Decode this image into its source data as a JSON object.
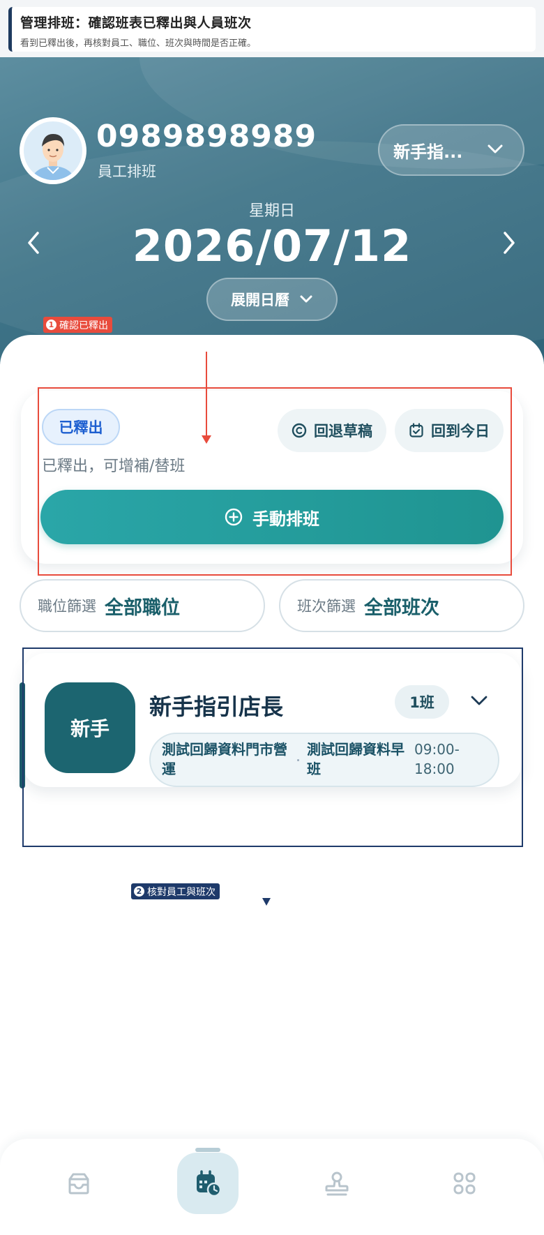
{
  "banner": {
    "title": "管理排班：確認班表已釋出與人員班次",
    "subtitle": "看到已釋出後，再核對員工、職位、班次與時間是否正確。"
  },
  "header": {
    "phone": "0989898989",
    "role": "員工排班",
    "role_selector": "新手指...",
    "weekday": "星期日",
    "date": "2026/07/12",
    "calendar_toggle": "展開日曆"
  },
  "annotations": {
    "step1_num": "1",
    "step1_label": "確認已釋出",
    "step2_num": "2",
    "step2_label": "核對員工與班次"
  },
  "status": {
    "badge": "已釋出",
    "revert_button": "回退草稿",
    "today_button": "回到今日",
    "description": "已釋出，可增補/替班",
    "manual_button": "手動排班"
  },
  "filters": {
    "position_key": "職位篩選",
    "position_value": "全部職位",
    "shift_key": "班次篩選",
    "shift_value": "全部班次"
  },
  "employees": [
    {
      "tile": "新手",
      "name": "新手指引店長",
      "shift_count": "1班",
      "store": "測試回歸資料門市營運",
      "shift": "測試回歸資料早班",
      "time": "09:00-18:00"
    }
  ],
  "bottom_nav": {
    "items": [
      "inbox-icon",
      "calendar-clock-icon",
      "stamp-icon",
      "apps-grid-icon"
    ],
    "active_index": 1
  },
  "colors": {
    "accent": "#1f9491",
    "annotation_red": "#e84b3c",
    "annotation_navy": "#1e3a6a",
    "released_blue": "#1d5fd0"
  }
}
